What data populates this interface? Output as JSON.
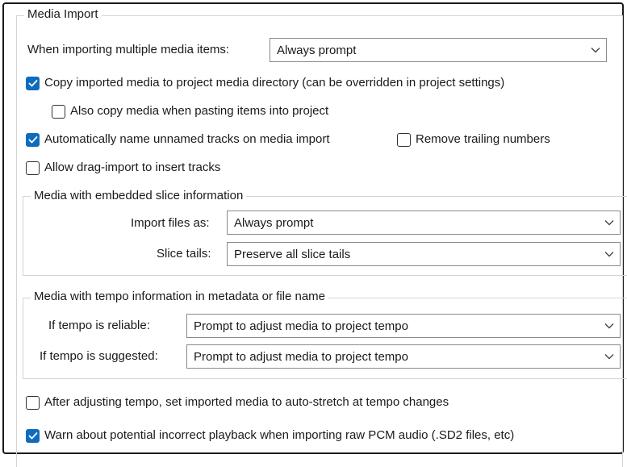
{
  "group_media_import": {
    "title": "Media Import",
    "multiple_items_label": "When importing multiple media items:",
    "multiple_items_value": "Always prompt",
    "copy_media": {
      "label": "Copy imported media to project media directory (can be overridden in project settings)",
      "checked": true
    },
    "copy_paste": {
      "label": "Also copy media when pasting items into project",
      "checked": false
    },
    "auto_name": {
      "label": "Automatically name unnamed tracks on media import",
      "checked": true
    },
    "remove_trailing": {
      "label": "Remove trailing numbers",
      "checked": false
    },
    "drag_import": {
      "label": "Allow drag-import to insert tracks",
      "checked": false
    },
    "after_tempo": {
      "label": "After adjusting tempo, set imported media to auto-stretch at tempo changes",
      "checked": false
    },
    "warn_pcm": {
      "label": "Warn about potential incorrect playback when importing raw PCM audio (.SD2 files, etc)",
      "checked": true
    }
  },
  "group_slice": {
    "title": "Media with embedded slice information",
    "import_as_label": "Import files as:",
    "import_as_value": "Always prompt",
    "slice_tails_label": "Slice tails:",
    "slice_tails_value": "Preserve all slice tails"
  },
  "group_tempo": {
    "title": "Media with tempo information in metadata or file name",
    "reliable_label": "If tempo is reliable:",
    "reliable_value": "Prompt to adjust media to project tempo",
    "suggested_label": "If tempo is suggested:",
    "suggested_value": "Prompt to adjust media to project tempo"
  },
  "icons": {
    "dropdown": "chevron-down-icon",
    "check": "checkmark-icon"
  },
  "colors": {
    "checkbox_checked": "#0f6cbd",
    "border": "#d4d4d4"
  }
}
